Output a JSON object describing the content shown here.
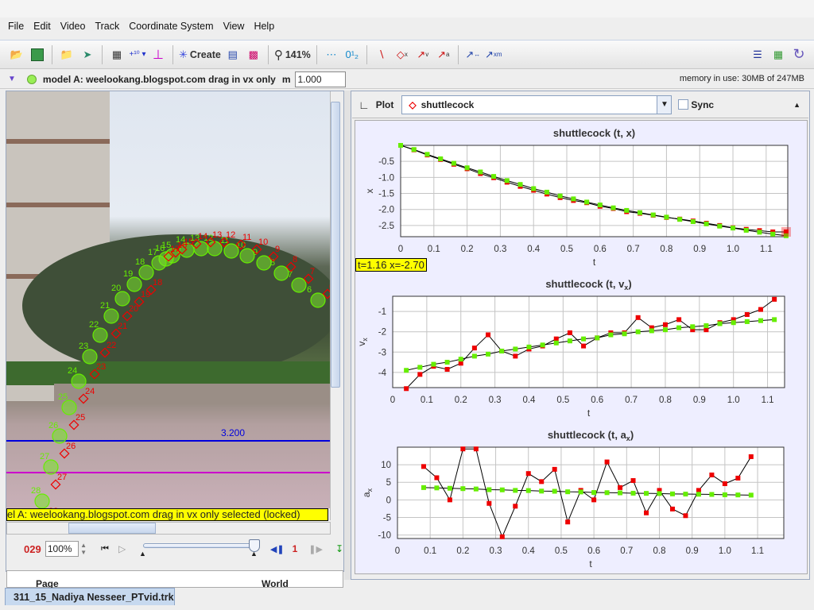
{
  "menu": [
    "File",
    "Edit",
    "Video",
    "Track",
    "Coordinate System",
    "View",
    "Help"
  ],
  "toolbar": {
    "create_label": "Create",
    "zoom_label": "141%",
    "icons": [
      "open-icon",
      "save-icon",
      "open-browser-icon",
      "import-icon",
      "video-clip-icon",
      "calibration-icon",
      "axes-icon",
      "create-icon",
      "clip-settings-icon",
      "track-control-icon",
      "zoom-icon",
      "trails-icon",
      "labels-icon",
      "path-icon",
      "position-icon",
      "velocity-icon",
      "acceleration-icon",
      "xmass-icon",
      "xm-icon",
      "notes-icon",
      "info-icon",
      "refresh-icon"
    ]
  },
  "infobar": {
    "model_label": "model A: weelookang.blogspot.com drag in vx only",
    "mass_label": "m",
    "mass_value": "1.000",
    "memory": "memory in use: 30MB of 247MB"
  },
  "video": {
    "tape_label": "3.200",
    "status": "el A: weelookang.blogspot.com drag in vx only selected (locked)",
    "frames": [
      6,
      7,
      8,
      9,
      10,
      11,
      12,
      13,
      14,
      15,
      16,
      17,
      18,
      19,
      20,
      21,
      22,
      23,
      24,
      25,
      26,
      27,
      28
    ]
  },
  "player": {
    "frame": "029",
    "rate": "100%",
    "step": "1"
  },
  "bottom": {
    "left_label": "Page",
    "right_label": "World"
  },
  "file_tab": "311_15_Nadiya Nesseer_PTvid.trk",
  "plot": {
    "label": "Plot",
    "track": "shuttlecock",
    "sync": "Sync",
    "readout": "t=1.16  x=-2.70"
  },
  "colors": {
    "data": "#ee0000",
    "model": "#66ee00",
    "tape": "#0000dd",
    "axis": "#cc00cc"
  },
  "chart_data": [
    {
      "type": "line",
      "title": "shuttlecock (t, x)",
      "xlabel": "t",
      "ylabel": "x",
      "xlim": [
        0,
        1.165
      ],
      "ylim": [
        -2.85,
        0
      ],
      "grid": true,
      "xticks": [
        "0",
        "0.1",
        "0.2",
        "0.3",
        "0.4",
        "0.5",
        "0.6",
        "0.7",
        "0.8",
        "0.9",
        "1.0",
        "1.1"
      ],
      "yticks": [
        "-0.5",
        "-1.0",
        "-1.5",
        "-2.0",
        "-2.5"
      ],
      "x": [
        0,
        0.04,
        0.08,
        0.12,
        0.16,
        0.2,
        0.24,
        0.28,
        0.32,
        0.36,
        0.4,
        0.44,
        0.48,
        0.52,
        0.56,
        0.6,
        0.64,
        0.68,
        0.72,
        0.76,
        0.8,
        0.84,
        0.88,
        0.92,
        0.96,
        1.0,
        1.04,
        1.08,
        1.12,
        1.16
      ],
      "series": [
        {
          "values": [
            0,
            -0.14,
            -0.3,
            -0.44,
            -0.59,
            -0.73,
            -0.88,
            -1.01,
            -1.15,
            -1.28,
            -1.4,
            -1.52,
            -1.63,
            -1.72,
            -1.79,
            -1.9,
            -1.97,
            -2.07,
            -2.12,
            -2.18,
            -2.25,
            -2.3,
            -2.36,
            -2.43,
            -2.5,
            -2.57,
            -2.62,
            -2.66,
            -2.7,
            -2.7
          ]
        },
        {
          "values": [
            0,
            -0.13,
            -0.28,
            -0.42,
            -0.56,
            -0.7,
            -0.83,
            -0.97,
            -1.1,
            -1.22,
            -1.35,
            -1.46,
            -1.58,
            -1.67,
            -1.77,
            -1.86,
            -1.95,
            -2.03,
            -2.1,
            -2.17,
            -2.24,
            -2.31,
            -2.38,
            -2.45,
            -2.52,
            -2.58,
            -2.65,
            -2.71,
            -2.77,
            -2.82
          ]
        }
      ]
    },
    {
      "type": "line",
      "title": "shuttlecock (t, v",
      "title_sub": "x",
      "title_end": ")",
      "xlabel": "t",
      "ylabel": "v",
      "ylabel_sub": "x",
      "xlim": [
        0,
        1.15
      ],
      "ylim": [
        -4.75,
        -0.25
      ],
      "grid": true,
      "xticks": [
        "0",
        "0.1",
        "0.2",
        "0.3",
        "0.4",
        "0.5",
        "0.6",
        "0.7",
        "0.8",
        "0.9",
        "1.0",
        "1.1"
      ],
      "yticks": [
        "-1",
        "-2",
        "-3",
        "-4"
      ],
      "x": [
        0.04,
        0.08,
        0.12,
        0.16,
        0.2,
        0.24,
        0.28,
        0.32,
        0.36,
        0.4,
        0.44,
        0.48,
        0.52,
        0.56,
        0.6,
        0.64,
        0.68,
        0.72,
        0.76,
        0.8,
        0.84,
        0.88,
        0.92,
        0.96,
        1.0,
        1.04,
        1.08,
        1.12
      ],
      "series": [
        {
          "values": [
            -4.8,
            -4.1,
            -3.7,
            -3.85,
            -3.55,
            -2.8,
            -2.15,
            -2.95,
            -3.2,
            -2.85,
            -2.7,
            -2.35,
            -2.05,
            -2.7,
            -2.3,
            -2.05,
            -2.05,
            -1.3,
            -1.8,
            -1.65,
            -1.4,
            -1.9,
            -1.9,
            -1.55,
            -1.4,
            -1.15,
            -0.9,
            -0.4
          ]
        },
        {
          "values": [
            -3.9,
            -3.75,
            -3.6,
            -3.5,
            -3.35,
            -3.2,
            -3.1,
            -2.95,
            -2.85,
            -2.75,
            -2.65,
            -2.55,
            -2.45,
            -2.35,
            -2.3,
            -2.15,
            -2.1,
            -2.0,
            -1.95,
            -1.9,
            -1.8,
            -1.75,
            -1.7,
            -1.6,
            -1.55,
            -1.5,
            -1.45,
            -1.4
          ]
        }
      ]
    },
    {
      "type": "line",
      "title": "shuttlecock (t, a",
      "title_sub": "x",
      "title_end": ")",
      "xlabel": "t",
      "ylabel": "a",
      "ylabel_sub": "x",
      "xlim": [
        0,
        1.18
      ],
      "ylim": [
        -11,
        15
      ],
      "grid": true,
      "xticks": [
        "0",
        "0.1",
        "0.2",
        "0.3",
        "0.4",
        "0.5",
        "0.6",
        "0.7",
        "0.8",
        "0.9",
        "1.0",
        "1.1"
      ],
      "yticks": [
        "10",
        "5",
        "0",
        "-5",
        "-10"
      ],
      "x": [
        0.08,
        0.12,
        0.16,
        0.2,
        0.24,
        0.28,
        0.32,
        0.36,
        0.4,
        0.44,
        0.48,
        0.52,
        0.56,
        0.6,
        0.64,
        0.68,
        0.72,
        0.76,
        0.8,
        0.84,
        0.88,
        0.92,
        0.96,
        1.0,
        1.04,
        1.08
      ],
      "series": [
        {
          "values": [
            9.5,
            6.3,
            0,
            14.5,
            14.5,
            -1,
            -10.5,
            -1.8,
            7.5,
            5.2,
            8.7,
            -6.3,
            2.7,
            0,
            10.8,
            3.5,
            5.5,
            -3.7,
            2.7,
            -2.6,
            -4.5,
            2.7,
            7.1,
            4.6,
            6.2,
            12.3
          ]
        },
        {
          "values": [
            3.5,
            3.4,
            3.3,
            3.2,
            3.1,
            2.9,
            2.85,
            2.7,
            2.65,
            2.5,
            2.45,
            2.3,
            2.25,
            2.1,
            2.05,
            2.0,
            1.9,
            1.85,
            1.8,
            1.7,
            1.65,
            1.6,
            1.55,
            1.45,
            1.4,
            1.35
          ]
        }
      ]
    }
  ]
}
